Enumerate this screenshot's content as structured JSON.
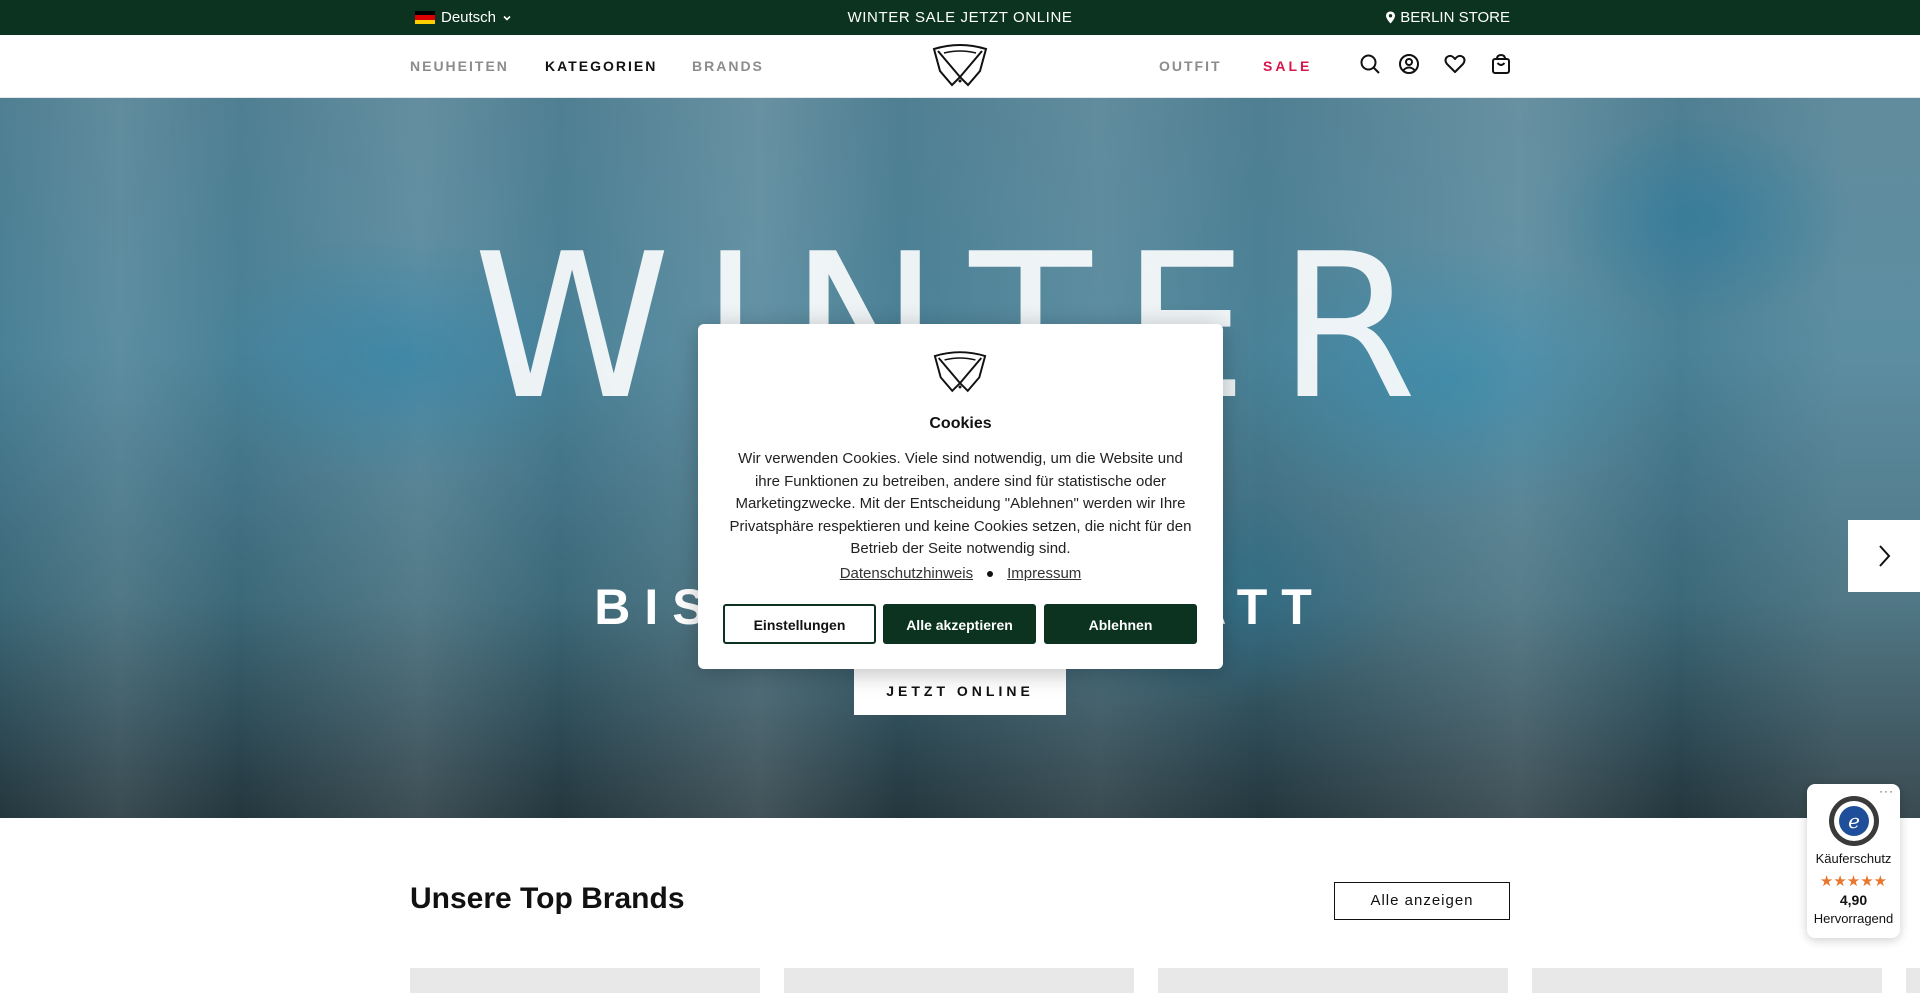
{
  "topbar": {
    "language": "Deutsch",
    "promo": "WINTER SALE JETZT ONLINE",
    "store": "BERLIN STORE"
  },
  "nav": {
    "items": [
      {
        "label": "NEUHEITEN"
      },
      {
        "label": "KATEGORIEN"
      },
      {
        "label": "BRANDS"
      },
      {
        "label": "OUTFIT"
      },
      {
        "label": "SALE"
      }
    ],
    "icons": [
      "search-icon",
      "account-icon",
      "wishlist-icon",
      "cart-icon"
    ]
  },
  "hero": {
    "headline": "WINTER",
    "subline": "BIS ZU 50% RABATT",
    "cta": "JETZT ONLINE",
    "colors": {
      "top": "#4f7f92",
      "bottom": "#24363d"
    }
  },
  "cookie_modal": {
    "title": "Cookies",
    "text": "Wir verwenden Cookies. Viele sind notwendig, um die Website und ihre Funktionen zu betreiben, andere sind für statistische oder Marketingzwecke. Mit der Entscheidung \"Ablehnen\" werden wir Ihre Privatsphäre respektieren und keine Cookies setzen, die nicht für den Betrieb der Seite notwendig sind.",
    "link_privacy": "Datenschutzhinweis",
    "link_imprint": "Impressum",
    "btn_settings": "Einstellungen",
    "btn_accept": "Alle akzeptieren",
    "btn_decline": "Ablehnen"
  },
  "brands_section": {
    "title": "Unsere Top Brands",
    "show_all": "Alle anzeigen"
  },
  "trust_badge": {
    "label": "Käuferschutz",
    "stars": "★★★★★",
    "rating": "4,90",
    "verdict": "Hervorragend"
  },
  "colors": {
    "brand_green": "#0b331f",
    "sale_red": "#d6174b",
    "star_orange": "#e8762c"
  }
}
